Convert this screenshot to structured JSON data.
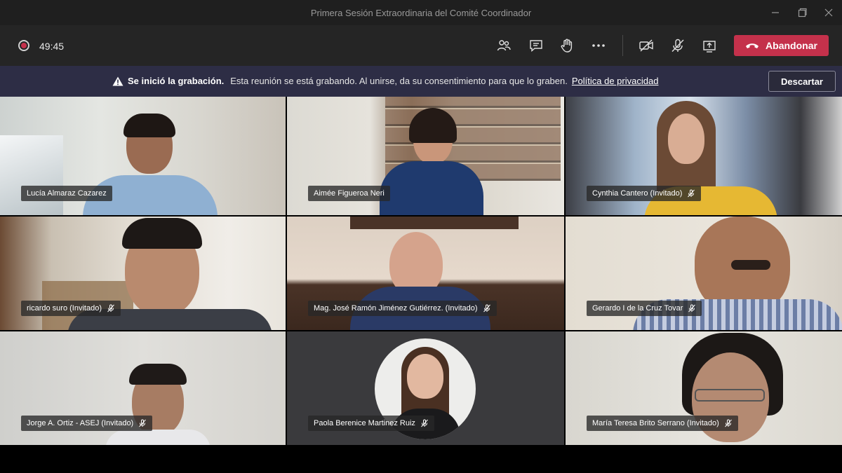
{
  "window": {
    "title": "Primera Sesión Extraordinaria del Comité Coordinador"
  },
  "toolbar": {
    "timer": "49:45",
    "leave_label": "Abandonar"
  },
  "banner": {
    "bold": "Se inició la grabación.",
    "text": "Esta reunión se está grabando. Al unirse, da su consentimiento para que lo graben.",
    "link": "Política de privacidad",
    "dismiss_label": "Descartar"
  },
  "participants": [
    {
      "name": "Lucía Almaraz Cazarez",
      "mic": false
    },
    {
      "name": "Aimée Figueroa Neri",
      "mic": false
    },
    {
      "name": "Cynthia Cantero (Invitado)",
      "mic": true
    },
    {
      "name": "ricardo suro (Invitado)",
      "mic": true
    },
    {
      "name": "Mag. José Ramón Jiménez Gutiérrez. (Invitado)",
      "mic": true
    },
    {
      "name": "Gerardo I de la Cruz Tovar",
      "mic": true
    },
    {
      "name": "Jorge A. Ortiz - ASEJ (Invitado)",
      "mic": true
    },
    {
      "name": "Paola Berenice Martinez Ruiz",
      "mic": true
    },
    {
      "name": "María Teresa Brito Serrano (Invitado)",
      "mic": true
    }
  ],
  "colors": {
    "leave": "#c4314b",
    "banner": "#2d2d45",
    "toolbar": "#252525"
  }
}
